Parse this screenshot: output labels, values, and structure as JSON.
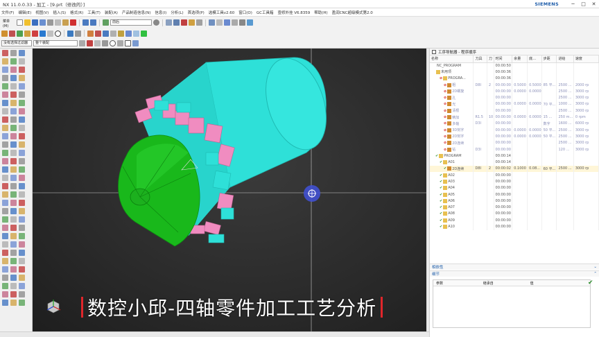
{
  "window": {
    "title": "NX 11.0.0.33 - 加工 - [9.prt（修改的）]",
    "brand": "SIEMENS",
    "min": "─",
    "max": "□",
    "close": "✕"
  },
  "menu": [
    "文件(F)",
    "编辑(E)",
    "视图(V)",
    "插入(S)",
    "格式(R)",
    "工具(T)",
    "装配(A)",
    "产品制造信息(N)",
    "信息(I)",
    "分析(L)",
    "首选项(P)",
    "选模工具v2.60",
    "窗口(O)",
    "GC工具箱",
    "壹修外挂 V6.8359",
    "帮助(H)",
    "盈润CNC超级模式第2.0"
  ],
  "toolbar": {
    "menu_label": "菜单(M)",
    "filter": "前后",
    "type_filter": "整个装配",
    "select_filter": "没有选择过滤器"
  },
  "navigator": {
    "title": "工序导航器 - 程序顺序",
    "columns": [
      "名称",
      "刀具",
      "刀",
      "时间",
      "余量",
      "底…",
      "步距",
      "进给",
      "速度"
    ],
    "rows": [
      {
        "name": "NC_PROGRAM",
        "tool": "",
        "n": "",
        "time": "00:00:50",
        "stock": "",
        "floor": "",
        "step": "",
        "feed": "",
        "speed": "",
        "indent": 0,
        "kind": "root"
      },
      {
        "name": "未用项",
        "tool": "",
        "n": "",
        "time": "00:00:36",
        "stock": "",
        "floor": "",
        "step": "",
        "feed": "",
        "speed": "",
        "indent": 1,
        "kind": "group"
      },
      {
        "name": "PROGRA...",
        "tool": "",
        "n": "",
        "time": "00:00:36",
        "stock": "",
        "floor": "",
        "step": "",
        "feed": "",
        "speed": "",
        "indent": 2,
        "kind": "prog"
      },
      {
        "name": "粗",
        "tool": "D8I",
        "n": "2",
        "time": "00:00:00",
        "stock": "0.5000",
        "floor": "0.5000",
        "step": "85 平...",
        "feed": "2500 ...",
        "speed": "2000 rp",
        "indent": 3,
        "kind": "op"
      },
      {
        "name": "2D螺旋",
        "tool": "",
        "n": "",
        "time": "00:00:00",
        "stock": "0.0000",
        "floor": "0.0000",
        "step": "",
        "feed": "2500 ...",
        "speed": "3000 rp",
        "indent": 3,
        "kind": "op"
      },
      {
        "name": "孔",
        "tool": "",
        "n": "",
        "time": "00:00:00",
        "stock": "",
        "floor": "",
        "step": "",
        "feed": "2500 ...",
        "speed": "3000 rp",
        "indent": 3,
        "kind": "op"
      },
      {
        "name": "光",
        "tool": "",
        "n": "",
        "time": "00:00:00",
        "stock": "0.0000",
        "floor": "0.0000",
        "step": "70 平...",
        "feed": "1000 ...",
        "speed": "3000 rp",
        "indent": 3,
        "kind": "op"
      },
      {
        "name": "清根",
        "tool": "",
        "n": "",
        "time": "00:00:00",
        "stock": "",
        "floor": "",
        "step": "",
        "feed": "2500 ...",
        "speed": "3000 rp",
        "indent": 3,
        "kind": "op"
      },
      {
        "name": "精加",
        "tool": "R1.5",
        "n": "10",
        "time": "00:00:00",
        "stock": "0.0000",
        "floor": "0.0000",
        "step": "15 ...",
        "feed": "250 m...",
        "speed": "0 rpm",
        "indent": 3,
        "kind": "op"
      },
      {
        "name": "多轴",
        "tool": "D3I",
        "n": "",
        "time": "00:00:00",
        "stock": "",
        "floor": "",
        "step": "数字",
        "feed": "1600 ...",
        "speed": "6000 rp",
        "indent": 3,
        "kind": "op"
      },
      {
        "name": "3D刻字",
        "tool": "",
        "n": "",
        "time": "00:00:00",
        "stock": "0.0000",
        "floor": "0.0000",
        "step": "50 平...",
        "feed": "2500 ...",
        "speed": "3000 rp",
        "indent": 3,
        "kind": "op"
      },
      {
        "name": "2D刻字",
        "tool": "",
        "n": "",
        "time": "00:00:00",
        "stock": "0.0000",
        "floor": "0.0000",
        "step": "50 平...",
        "feed": "2500 ...",
        "speed": "3000 rp",
        "indent": 3,
        "kind": "op"
      },
      {
        "name": "2D连续",
        "tool": "",
        "n": "",
        "time": "00:00:00",
        "stock": "",
        "floor": "",
        "step": "",
        "feed": "2500 ...",
        "speed": "3000 rp",
        "indent": 3,
        "kind": "op"
      },
      {
        "name": "钻",
        "tool": "D3I",
        "n": "",
        "time": "00:00:00",
        "stock": "",
        "floor": "",
        "step": "",
        "feed": "120 ...",
        "speed": "3000 rp",
        "indent": 3,
        "kind": "op"
      },
      {
        "name": "PROGRAM",
        "tool": "",
        "n": "",
        "time": "00:00:14",
        "stock": "",
        "floor": "",
        "step": "",
        "feed": "",
        "speed": "",
        "indent": 1,
        "kind": "prog2"
      },
      {
        "name": "A01",
        "tool": "",
        "n": "",
        "time": "00:00:14",
        "stock": "",
        "floor": "",
        "step": "",
        "feed": "",
        "speed": "",
        "indent": 2,
        "kind": "sub"
      },
      {
        "name": "2D连续",
        "tool": "D8I",
        "n": "2",
        "time": "00:00:02",
        "stock": "0.1000",
        "floor": "0.08...",
        "step": "60 平...",
        "feed": "2500 ...",
        "speed": "3000 rp",
        "indent": 3,
        "kind": "active"
      },
      {
        "name": "A02",
        "tool": "",
        "n": "",
        "time": "00:00:00",
        "stock": "",
        "floor": "",
        "step": "",
        "feed": "",
        "speed": "",
        "indent": 2,
        "kind": "sub"
      },
      {
        "name": "A03",
        "tool": "",
        "n": "",
        "time": "00:00:00",
        "stock": "",
        "floor": "",
        "step": "",
        "feed": "",
        "speed": "",
        "indent": 2,
        "kind": "sub"
      },
      {
        "name": "A04",
        "tool": "",
        "n": "",
        "time": "00:00:00",
        "stock": "",
        "floor": "",
        "step": "",
        "feed": "",
        "speed": "",
        "indent": 2,
        "kind": "sub"
      },
      {
        "name": "A05",
        "tool": "",
        "n": "",
        "time": "00:00:00",
        "stock": "",
        "floor": "",
        "step": "",
        "feed": "",
        "speed": "",
        "indent": 2,
        "kind": "sub"
      },
      {
        "name": "A06",
        "tool": "",
        "n": "",
        "time": "00:00:00",
        "stock": "",
        "floor": "",
        "step": "",
        "feed": "",
        "speed": "",
        "indent": 2,
        "kind": "sub"
      },
      {
        "name": "A07",
        "tool": "",
        "n": "",
        "time": "00:00:00",
        "stock": "",
        "floor": "",
        "step": "",
        "feed": "",
        "speed": "",
        "indent": 2,
        "kind": "sub"
      },
      {
        "name": "A08",
        "tool": "",
        "n": "",
        "time": "00:00:00",
        "stock": "",
        "floor": "",
        "step": "",
        "feed": "",
        "speed": "",
        "indent": 2,
        "kind": "sub"
      },
      {
        "name": "A09",
        "tool": "",
        "n": "",
        "time": "00:00:00",
        "stock": "",
        "floor": "",
        "step": "",
        "feed": "",
        "speed": "",
        "indent": 2,
        "kind": "sub"
      },
      {
        "name": "A10",
        "tool": "",
        "n": "",
        "time": "00:00:00",
        "stock": "",
        "floor": "",
        "step": "",
        "feed": "",
        "speed": "",
        "indent": 2,
        "kind": "sub"
      }
    ]
  },
  "dependency_section": "相依性",
  "details_section": "细节",
  "details_columns": [
    "参数",
    "继承自",
    "值"
  ],
  "banner_text": "数控小邱-四轴零件加工工艺分析",
  "colors": {
    "cylinder": "#2ee0d8",
    "cone": "#19b81b",
    "pads": "#f08cc0",
    "accent": "#1a5aa8",
    "banner_bar": "#e0262b"
  }
}
